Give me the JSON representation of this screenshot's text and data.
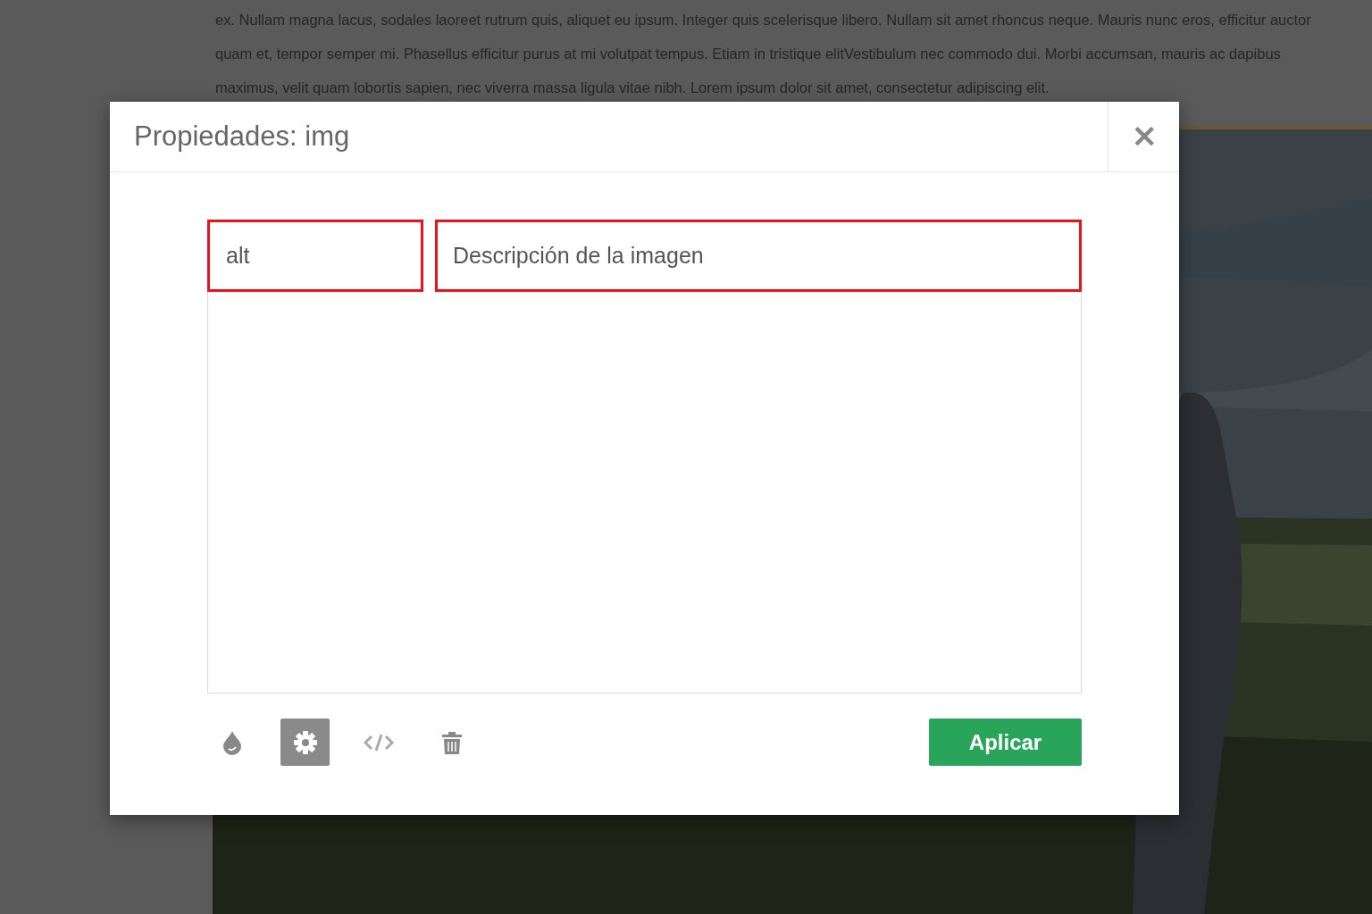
{
  "background_text": [
    "ex. Nullam magna lacus, sodales laoreet rutrum quis, aliquet eu ipsum. Integer quis scelerisque libero. Nullam sit amet rhoncus neque. Mauris nunc eros, efficitur auctor",
    "quam et, tempor semper mi. Phasellus efficitur purus at mi volutpat tempus. Etiam in tristique elitVestibulum nec commodo dui. Morbi accumsan, mauris ac dapibus",
    "maximus, velit quam lobortis sapien, nec viverra massa ligula vitae nibh. Lorem ipsum dolor sit amet, consectetur adipiscing elit."
  ],
  "background_image": {
    "kind": "picture"
  },
  "dialog": {
    "title": "Propiedades: img",
    "close": "✕",
    "attribute": {
      "name": "alt",
      "value": "Descripción de la imagen",
      "highlighted": true
    },
    "tools": [
      {
        "kind": "color",
        "selected": false
      },
      {
        "kind": "settings",
        "selected": true
      },
      {
        "kind": "code",
        "selected": false
      },
      {
        "kind": "delete",
        "selected": false
      }
    ],
    "apply_button": "Aplicar"
  }
}
